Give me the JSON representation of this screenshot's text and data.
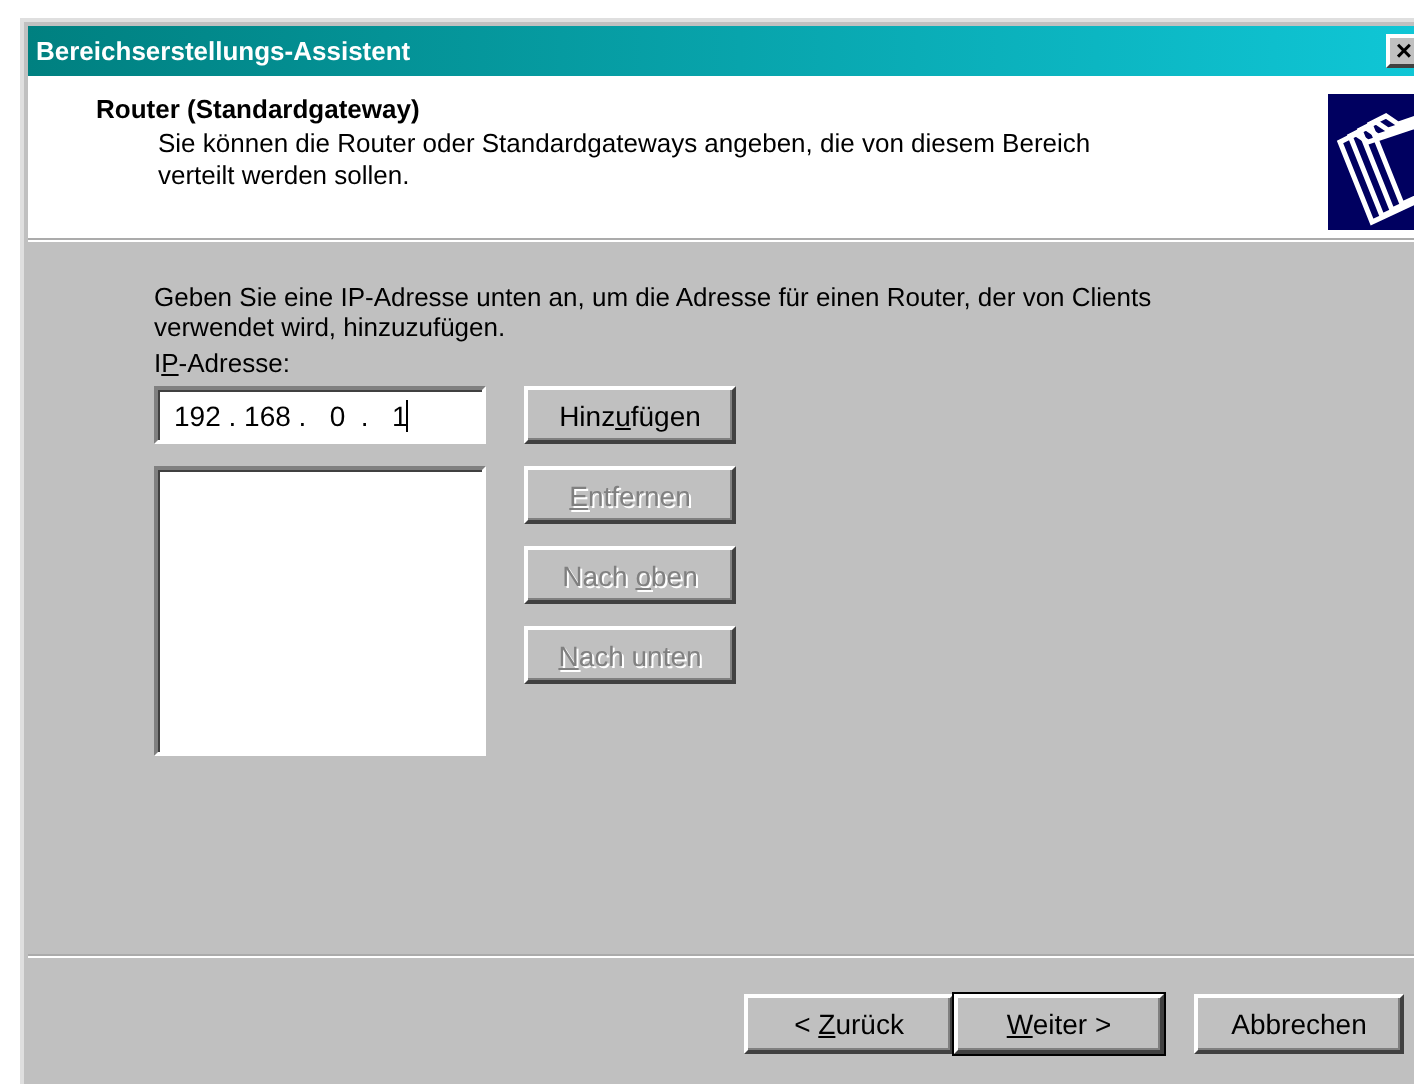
{
  "window": {
    "title": "Bereichserstellungs-Assistent",
    "close": "×"
  },
  "header": {
    "title": "Router (Standardgateway)",
    "subtitle": "Sie können die Router oder Standardgateways angeben, die von diesem Bereich verteilt werden sollen."
  },
  "instructions": "Geben Sie eine IP-Adresse unten an, um die Adresse für einen Router, der von Clients verwendet wird, hinzuzufügen.",
  "ip_field": {
    "label": {
      "pre": "I",
      "key": "P",
      "post": "-Adresse:"
    },
    "value": "192 . 168 .   0  .   1"
  },
  "side_buttons": [
    {
      "label": {
        "pre": "Hinz",
        "key": "u",
        "post": "fügen"
      },
      "disabled": false
    },
    {
      "label": {
        "key": "E",
        "post": "ntfernen"
      },
      "disabled": true
    },
    {
      "label": {
        "pre": "Nach ",
        "key": "o",
        "post": "ben"
      },
      "disabled": true
    },
    {
      "label": {
        "key": "N",
        "post": "ach unten"
      },
      "disabled": true
    }
  ],
  "nav_buttons": [
    {
      "label": {
        "pre": "< ",
        "key": "Z",
        "post": "urück"
      },
      "default": false
    },
    {
      "label": {
        "key": "W",
        "post": "eiter >"
      },
      "default": true
    },
    {
      "label": {
        "pre": "Abbrechen"
      },
      "default": false
    }
  ]
}
